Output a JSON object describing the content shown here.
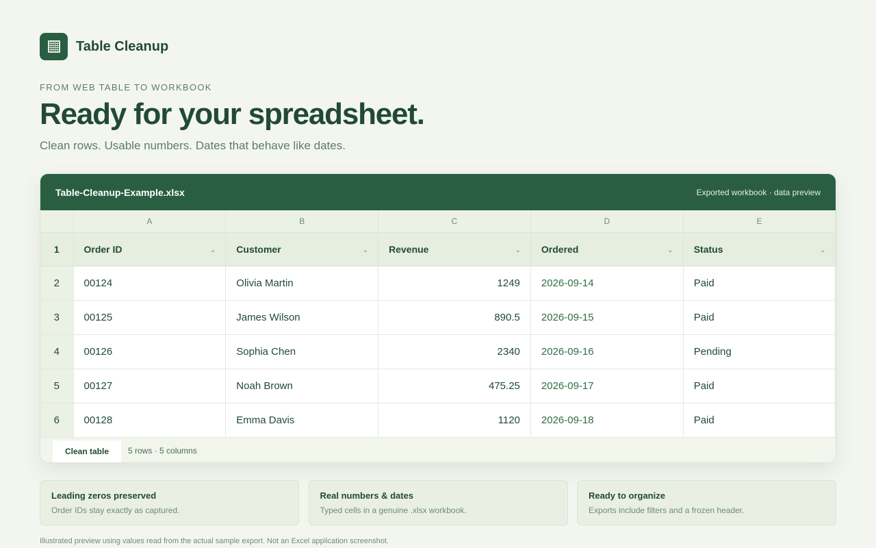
{
  "brand": {
    "name": "Table Cleanup",
    "icon": "grid-icon"
  },
  "hero": {
    "eyebrow": "FROM WEB TABLE TO WORKBOOK",
    "title": "Ready for your spreadsheet.",
    "subtitle": "Clean rows. Usable numbers. Dates that behave like dates."
  },
  "sheet": {
    "file_name": "Table-Cleanup-Example.xlsx",
    "meta": "Exported workbook · data preview",
    "column_letters": [
      "A",
      "B",
      "C",
      "D",
      "E"
    ],
    "header_row_number": "1",
    "headers": [
      "Order ID",
      "Customer",
      "Revenue",
      "Ordered",
      "Status"
    ],
    "filter_glyph": "⌄",
    "rows": [
      {
        "n": "2",
        "cells": [
          "00124",
          "Olivia Martin",
          "1249",
          "2026-09-14",
          "Paid"
        ]
      },
      {
        "n": "3",
        "cells": [
          "00125",
          "James Wilson",
          "890.5",
          "2026-09-15",
          "Paid"
        ]
      },
      {
        "n": "4",
        "cells": [
          "00126",
          "Sophia Chen",
          "2340",
          "2026-09-16",
          "Pending"
        ]
      },
      {
        "n": "5",
        "cells": [
          "00127",
          "Noah Brown",
          "475.25",
          "2026-09-17",
          "Paid"
        ]
      },
      {
        "n": "6",
        "cells": [
          "00128",
          "Emma Davis",
          "1120",
          "2026-09-18",
          "Paid"
        ]
      }
    ],
    "tab_label": "Clean table",
    "summary": "5 rows · 5 columns"
  },
  "cards": [
    {
      "title": "Leading zeros preserved",
      "text": "Order IDs stay exactly as captured."
    },
    {
      "title": "Real numbers & dates",
      "text": "Typed cells in a genuine .xlsx workbook."
    },
    {
      "title": "Ready to organize",
      "text": "Exports include filters and a frozen header."
    }
  ],
  "footnote": "Illustrated preview using values read from the actual sample export. Not an Excel application screenshot.",
  "colors": {
    "accent": "#2a5e43",
    "background": "#f3f6ef",
    "date_text": "#2f6e47"
  }
}
